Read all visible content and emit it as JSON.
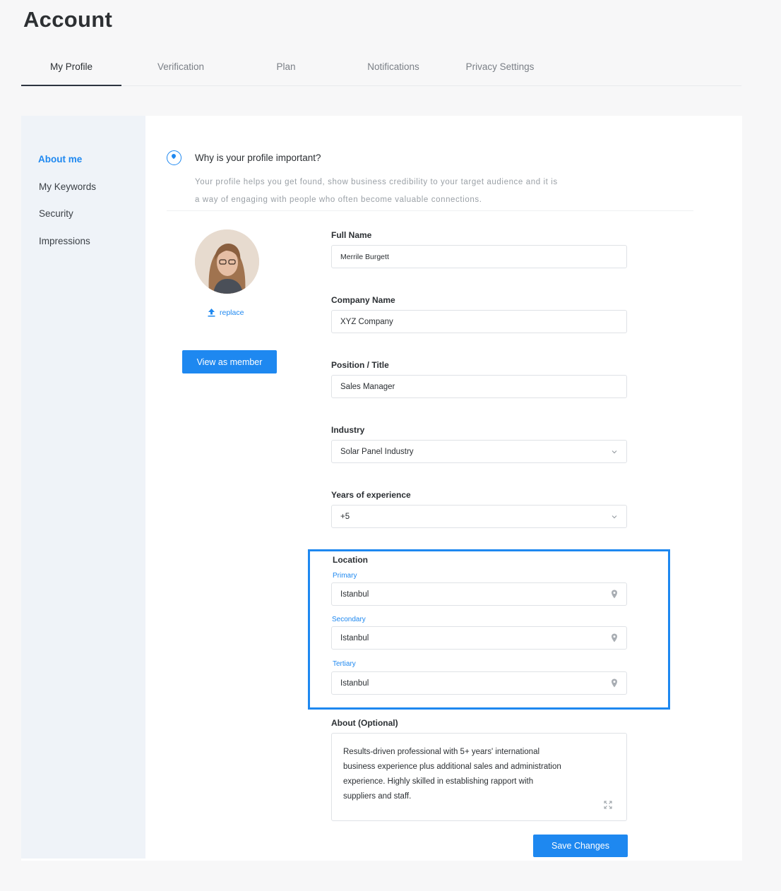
{
  "page": {
    "title": "Account"
  },
  "tabs": [
    {
      "label": "My Profile",
      "active": true
    },
    {
      "label": "Verification"
    },
    {
      "label": "Plan"
    },
    {
      "label": "Notifications"
    },
    {
      "label": "Privacy Settings"
    }
  ],
  "sidebar": {
    "items": [
      {
        "label": "About me",
        "active": true
      },
      {
        "label": "My Keywords"
      },
      {
        "label": "Security"
      },
      {
        "label": "Impressions"
      }
    ]
  },
  "info": {
    "title": "Why is your profile important?",
    "line1": "Your profile helps you get found, show business credibility to your target audience and it is",
    "line2": "a way of engaging with people who often become valuable connections."
  },
  "profile": {
    "replace_label": "replace",
    "view_button": "View as member"
  },
  "form": {
    "full_name": {
      "label": "Full Name",
      "value": "Merrile Burgett"
    },
    "company": {
      "label": "Company Name",
      "value": "XYZ Company"
    },
    "position": {
      "label": "Position / Title",
      "value": "Sales Manager"
    },
    "industry": {
      "label": "Industry",
      "value": "Solar Panel Industry"
    },
    "experience": {
      "label": "Years of experience",
      "value": "+5"
    },
    "location": {
      "label": "Location",
      "primary": {
        "label": "Primary",
        "value": "Istanbul"
      },
      "secondary": {
        "label": "Secondary",
        "value": "Istanbul"
      },
      "tertiary": {
        "label": "Tertiary",
        "value": "Istanbul"
      }
    },
    "about": {
      "label": "About (Optional)",
      "line1": "Results-driven professional with 5+ years' international",
      "line2": "business experience plus additional sales and administration",
      "line3": "experience. Highly skilled in establishing rapport with",
      "line4": "suppliers and staff."
    },
    "save_button": "Save Changes"
  },
  "colors": {
    "accent": "#1e88f0",
    "sidebar_bg": "#eff3f8"
  },
  "icons": {
    "info": "location-pin-circle-icon",
    "upload": "upload-icon",
    "dropdown": "chevron-down-icon",
    "pin": "map-pin-icon",
    "expand": "expand-icon"
  }
}
